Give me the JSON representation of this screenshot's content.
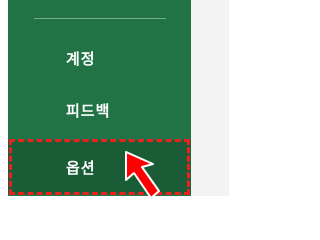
{
  "sidebar": {
    "items": [
      {
        "label": "계정"
      },
      {
        "label": "피드백"
      },
      {
        "label": "옵션"
      }
    ],
    "background_color": "#217346",
    "selected_background_color": "#1a5c36"
  },
  "annotation": {
    "highlight_color": "#e8231f",
    "arrow_icon": "red-arrow-icon"
  }
}
